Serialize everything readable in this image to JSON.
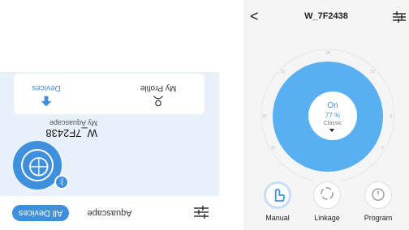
{
  "left_phone": {
    "tabs": {
      "all_devices": "All Devices",
      "aquascape": "Aquascape"
    },
    "device": {
      "name": "W_7F2438",
      "subtitle": "My Aquascape"
    },
    "bottom_card": {
      "devices": "Devices",
      "my_profile": "My Profile"
    },
    "icons": {
      "filter": "filter-icon",
      "bluetooth": "bluetooth-icon",
      "device": "dial-icon"
    }
  },
  "right_phone": {
    "header": {
      "back": "<",
      "title": "W_7F2438",
      "settings_icon": "settings-sliders-icon"
    },
    "dial": {
      "state": "On",
      "percent": "77 %",
      "mode": "Classic",
      "ticks": [
        "24",
        "21",
        "18",
        "15",
        "6",
        "9",
        "12"
      ],
      "level": 0.77,
      "ring_color": "#5AAFF0"
    },
    "modes": [
      {
        "label": "Manual",
        "icon": "hand-touch-icon",
        "active": true
      },
      {
        "label": "Linkage",
        "icon": "linkage-icon",
        "active": false
      },
      {
        "label": "Program",
        "icon": "timer-icon",
        "active": false
      }
    ]
  },
  "colors": {
    "accent": "#3E8FDC",
    "panel_bg": "#E8F1F9"
  }
}
